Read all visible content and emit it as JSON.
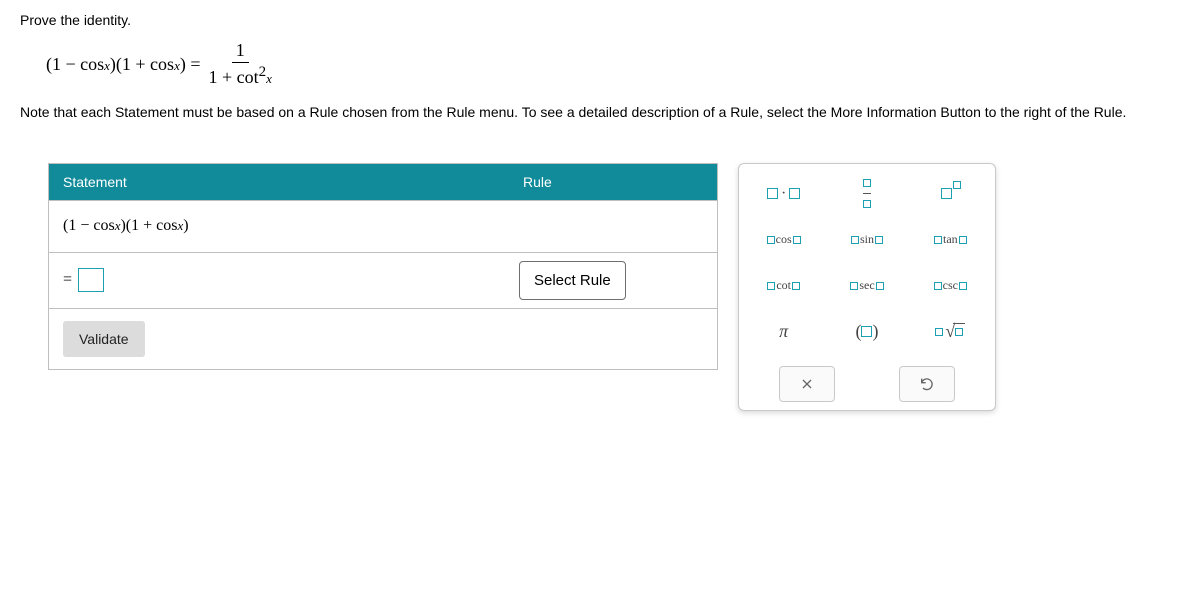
{
  "prompt": "Prove the identity.",
  "equation": {
    "lhs": "(1 − cos x)(1 + cos x) =",
    "frac_num": "1",
    "frac_den": "1 + cot²x"
  },
  "note": "Note that each Statement must be based on a Rule chosen from the Rule menu. To see a detailed description of a Rule, select the More Information Button to the right of the Rule.",
  "table": {
    "header_statement": "Statement",
    "header_rule": "Rule",
    "row1_statement": "(1 − cos x)(1 + cos x)",
    "row2_eq": "=",
    "select_rule_label": "Select Rule",
    "validate_label": "Validate"
  },
  "palette": {
    "fn_cos": "cos",
    "fn_sin": "sin",
    "fn_tan": "tan",
    "fn_cot": "cot",
    "fn_sec": "sec",
    "fn_csc": "csc",
    "pi": "π"
  }
}
